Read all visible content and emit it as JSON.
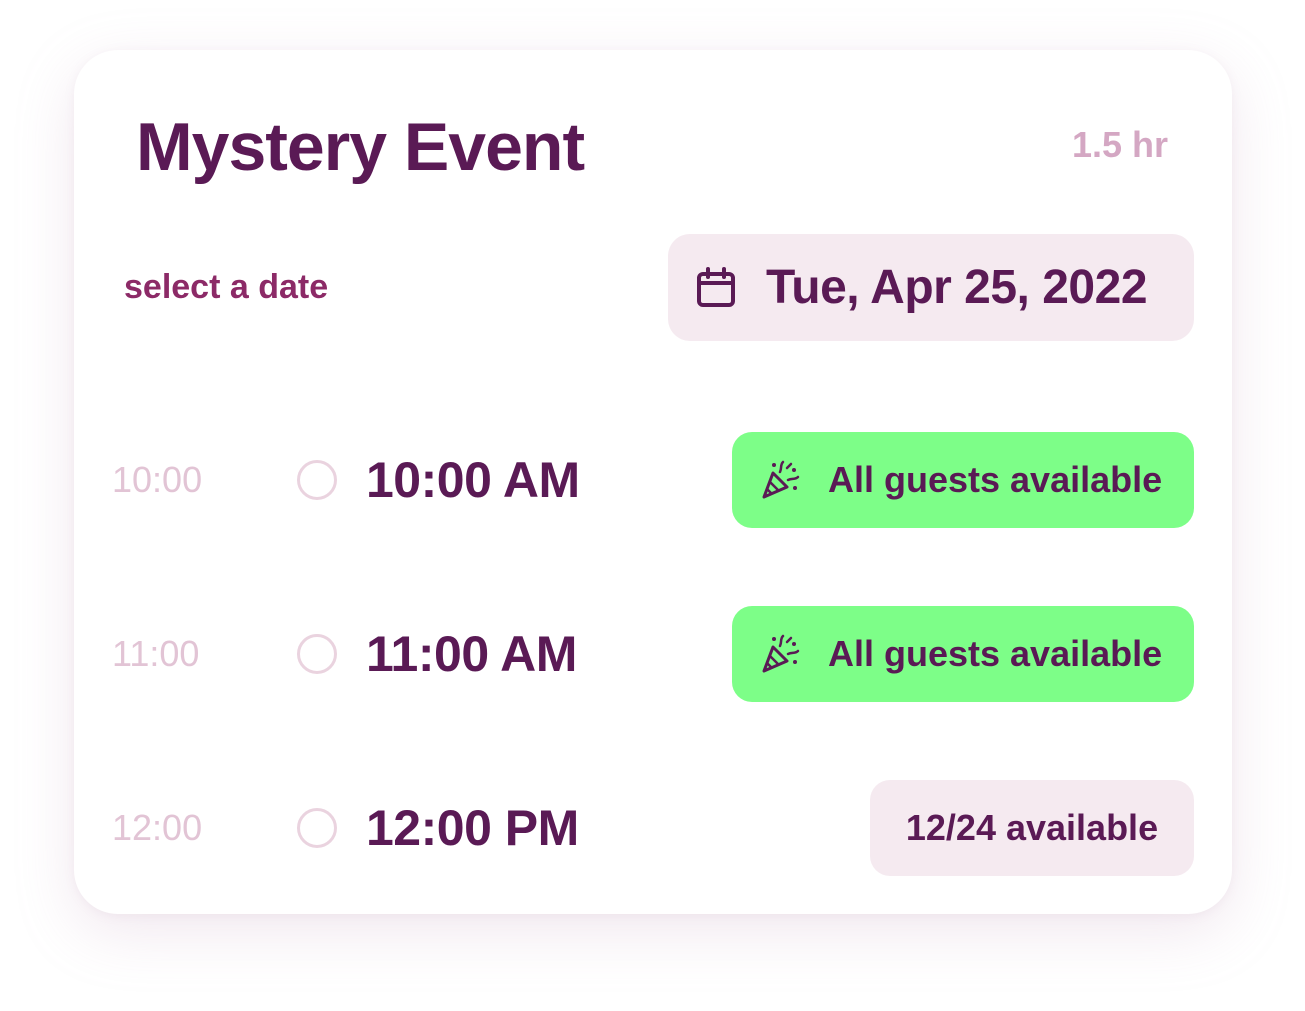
{
  "event": {
    "title": "Mystery Event",
    "duration": "1.5 hr"
  },
  "date_selector": {
    "label": "select a date",
    "selected_date": "Tue, Apr 25, 2022",
    "icon": "calendar-icon"
  },
  "slots": [
    {
      "short": "10:00",
      "time": "10:00 AM",
      "status": "All guests available",
      "status_type": "all",
      "icon": "party-popper-icon",
      "selected": false
    },
    {
      "short": "11:00",
      "time": "11:00 AM",
      "status": "All guests available",
      "status_type": "all",
      "icon": "party-popper-icon",
      "selected": false
    },
    {
      "short": "12:00",
      "time": "12:00 PM",
      "status": "12/24 available",
      "status_type": "partial",
      "selected": false
    }
  ],
  "colors": {
    "primary_text": "#5a1a55",
    "accent_label": "#8c2a67",
    "muted": "#d4a7c3",
    "available_green": "#7dfe88",
    "neutral_pill": "#f5eaf0"
  }
}
